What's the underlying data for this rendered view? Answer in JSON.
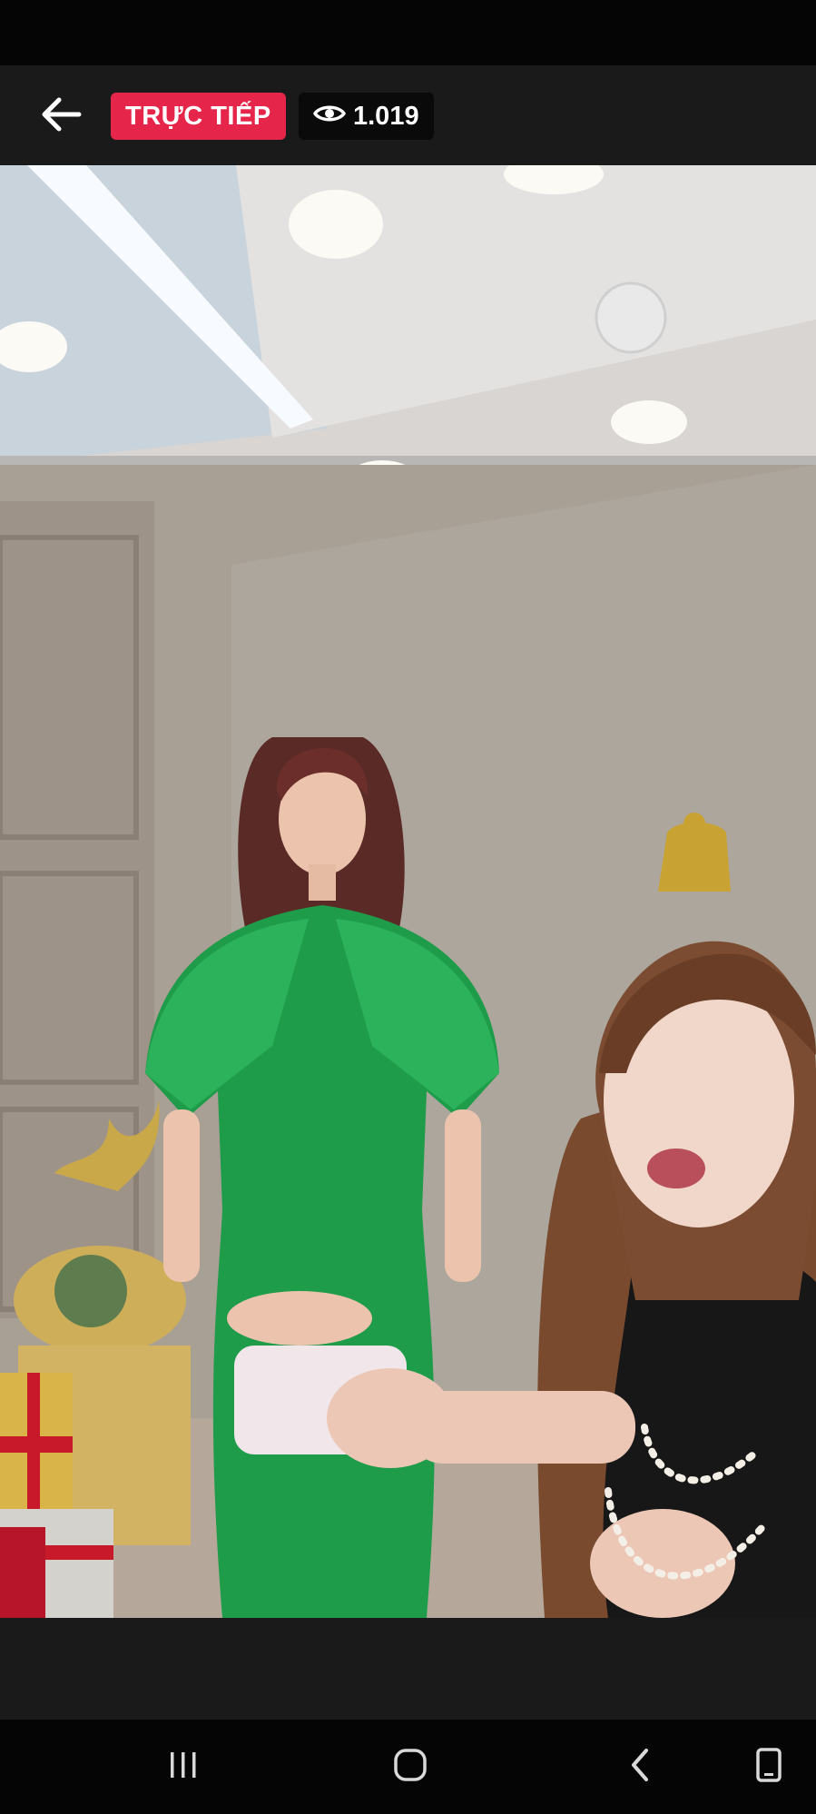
{
  "header": {
    "live_label": "TRỰC TIẾP",
    "viewer_count": "1.019"
  },
  "icons": {
    "back": "arrow-left-icon",
    "viewers": "eye-icon",
    "nav_recents": "recents-icon",
    "nav_home": "home-icon",
    "nav_back": "chevron-left-icon",
    "nav_extra": "phone-icon"
  },
  "colors": {
    "live_badge": "#e5264a",
    "top_bar": "#1a1a1b",
    "nav_bar": "#050505"
  }
}
